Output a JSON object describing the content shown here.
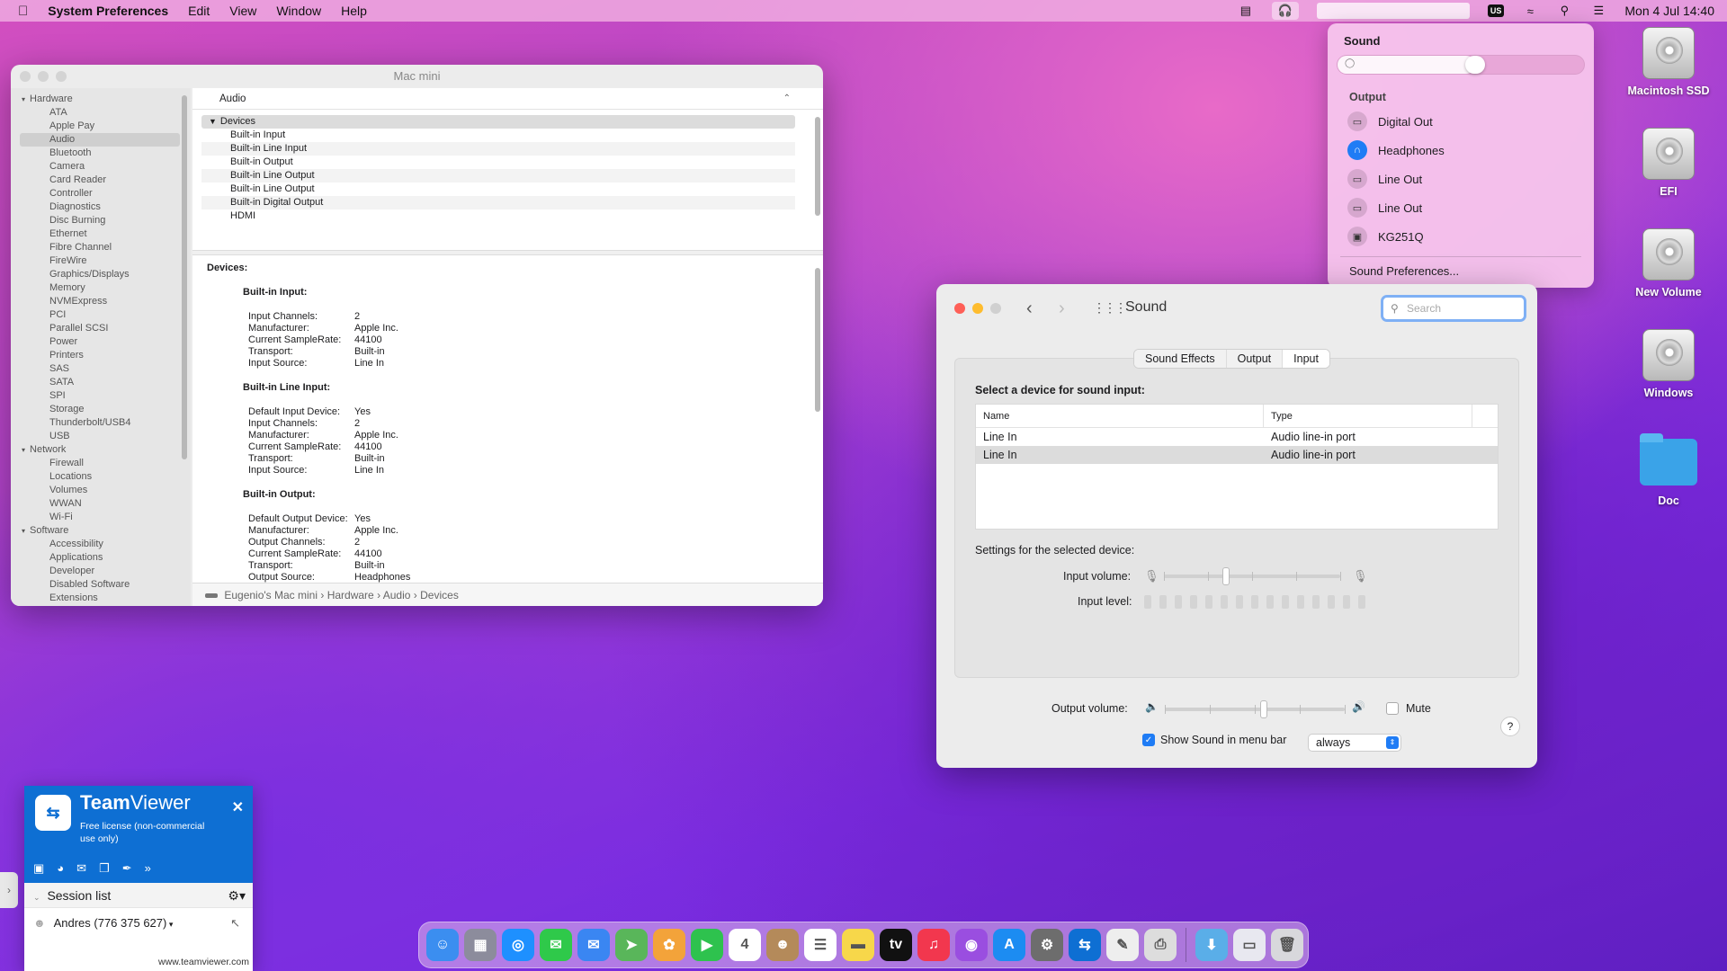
{
  "menubar": {
    "app_name": "System Preferences",
    "menus": [
      "Edit",
      "View",
      "Window",
      "Help"
    ],
    "keyboard_layout": "US",
    "datetime": "Mon 4 Jul  14:40"
  },
  "sysinfo": {
    "window_title": "Mac mini",
    "sidebar": [
      {
        "label": "Hardware",
        "type": "group"
      },
      {
        "label": "ATA",
        "type": "item"
      },
      {
        "label": "Apple Pay",
        "type": "item"
      },
      {
        "label": "Audio",
        "type": "item",
        "selected": true
      },
      {
        "label": "Bluetooth",
        "type": "item"
      },
      {
        "label": "Camera",
        "type": "item"
      },
      {
        "label": "Card Reader",
        "type": "item"
      },
      {
        "label": "Controller",
        "type": "item"
      },
      {
        "label": "Diagnostics",
        "type": "item"
      },
      {
        "label": "Disc Burning",
        "type": "item"
      },
      {
        "label": "Ethernet",
        "type": "item"
      },
      {
        "label": "Fibre Channel",
        "type": "item"
      },
      {
        "label": "FireWire",
        "type": "item"
      },
      {
        "label": "Graphics/Displays",
        "type": "item"
      },
      {
        "label": "Memory",
        "type": "item"
      },
      {
        "label": "NVMExpress",
        "type": "item"
      },
      {
        "label": "PCI",
        "type": "item"
      },
      {
        "label": "Parallel SCSI",
        "type": "item"
      },
      {
        "label": "Power",
        "type": "item"
      },
      {
        "label": "Printers",
        "type": "item"
      },
      {
        "label": "SAS",
        "type": "item"
      },
      {
        "label": "SATA",
        "type": "item"
      },
      {
        "label": "SPI",
        "type": "item"
      },
      {
        "label": "Storage",
        "type": "item"
      },
      {
        "label": "Thunderbolt/USB4",
        "type": "item"
      },
      {
        "label": "USB",
        "type": "item"
      },
      {
        "label": "Network",
        "type": "group"
      },
      {
        "label": "Firewall",
        "type": "item"
      },
      {
        "label": "Locations",
        "type": "item"
      },
      {
        "label": "Volumes",
        "type": "item"
      },
      {
        "label": "WWAN",
        "type": "item"
      },
      {
        "label": "Wi-Fi",
        "type": "item"
      },
      {
        "label": "Software",
        "type": "group"
      },
      {
        "label": "Accessibility",
        "type": "item"
      },
      {
        "label": "Applications",
        "type": "item"
      },
      {
        "label": "Developer",
        "type": "item"
      },
      {
        "label": "Disabled Software",
        "type": "item"
      },
      {
        "label": "Extensions",
        "type": "item"
      }
    ],
    "section_header": "Audio",
    "tree_root": "Devices",
    "tree_items": [
      "Built-in Input",
      "Built-in Line Input",
      "Built-in Output",
      "Built-in Line Output",
      "Built-in Line Output",
      "Built-in Digital Output",
      "HDMI"
    ],
    "detail_heading": "Devices:",
    "detail_blocks": [
      {
        "title": "Built-in Input:",
        "rows": [
          [
            "Input Channels:",
            "2"
          ],
          [
            "Manufacturer:",
            "Apple Inc."
          ],
          [
            "Current SampleRate:",
            "44100"
          ],
          [
            "Transport:",
            "Built-in"
          ],
          [
            "Input Source:",
            "Line In"
          ]
        ]
      },
      {
        "title": "Built-in Line Input:",
        "rows": [
          [
            "Default Input Device:",
            "Yes"
          ],
          [
            "Input Channels:",
            "2"
          ],
          [
            "Manufacturer:",
            "Apple Inc."
          ],
          [
            "Current SampleRate:",
            "44100"
          ],
          [
            "Transport:",
            "Built-in"
          ],
          [
            "Input Source:",
            "Line In"
          ]
        ]
      },
      {
        "title": "Built-in Output:",
        "rows": [
          [
            "Default Output Device:",
            "Yes"
          ],
          [
            "Manufacturer:",
            "Apple Inc."
          ],
          [
            "Output Channels:",
            "2"
          ],
          [
            "Current SampleRate:",
            "44100"
          ],
          [
            "Transport:",
            "Built-in"
          ],
          [
            "Output Source:",
            "Headphones"
          ]
        ]
      }
    ],
    "path": [
      "Eugenio's Mac mini",
      "Hardware",
      "Audio",
      "Devices"
    ]
  },
  "sound_popover": {
    "title": "Sound",
    "volume_fraction": 0.56,
    "output_label": "Output",
    "devices": [
      {
        "label": "Digital Out",
        "icon": "port-icon",
        "selected": false
      },
      {
        "label": "Headphones",
        "icon": "headphones-icon",
        "selected": true
      },
      {
        "label": "Line Out",
        "icon": "port-icon",
        "selected": false
      },
      {
        "label": "Line Out",
        "icon": "port-icon",
        "selected": false
      },
      {
        "label": "KG251Q",
        "icon": "display-icon",
        "selected": false
      }
    ],
    "preferences_link": "Sound Preferences..."
  },
  "sound_window": {
    "title": "Sound",
    "search_placeholder": "Search",
    "tabs": [
      "Sound Effects",
      "Output",
      "Input"
    ],
    "active_tab": "Input",
    "select_prompt": "Select a device for sound input:",
    "columns": [
      "Name",
      "Type"
    ],
    "rows": [
      [
        "Line In",
        "Audio line-in port"
      ],
      [
        "Line In",
        "Audio line-in port"
      ]
    ],
    "selected_row": 1,
    "settings_label": "Settings for the selected device:",
    "input_volume_label": "Input volume:",
    "input_volume_fraction": 0.35,
    "input_level_label": "Input level:",
    "output_volume_label": "Output volume:",
    "output_volume_fraction": 0.55,
    "mute_label": "Mute",
    "mute_checked": false,
    "show_in_menubar_label": "Show Sound in menu bar",
    "show_in_menubar_checked": true,
    "menubar_option": "always",
    "help": "?"
  },
  "desktop_icons": [
    {
      "label": "Macintosh SSD",
      "kind": "disk"
    },
    {
      "label": "EFI",
      "kind": "disk"
    },
    {
      "label": "New Volume",
      "kind": "disk"
    },
    {
      "label": "Windows",
      "kind": "disk"
    },
    {
      "label": "Doc",
      "kind": "folder"
    }
  ],
  "teamviewer": {
    "brand_a": "Team",
    "brand_b": "Viewer",
    "license": "Free license (non-commercial use only)",
    "session_list": "Session list",
    "user": "Andres (776 375 627)",
    "url": "www.teamviewer.com"
  },
  "dock": [
    {
      "name": "finder-icon",
      "color": "#3b8ef0",
      "glyph": "☺"
    },
    {
      "name": "launchpad-icon",
      "color": "#8c8c9c",
      "glyph": "▦"
    },
    {
      "name": "safari-icon",
      "color": "#1e90ff",
      "glyph": "◎"
    },
    {
      "name": "messages-icon",
      "color": "#2fc94a",
      "glyph": "✉"
    },
    {
      "name": "mail-icon",
      "color": "#3a86f2",
      "glyph": "✉"
    },
    {
      "name": "maps-icon",
      "color": "#59b65a",
      "glyph": "➤"
    },
    {
      "name": "photos-icon",
      "color": "#f3a33a",
      "glyph": "✿"
    },
    {
      "name": "facetime-icon",
      "color": "#2ec24e",
      "glyph": "▶"
    },
    {
      "name": "calendar-icon",
      "color": "#ffffff",
      "glyph": "4"
    },
    {
      "name": "contacts-icon",
      "color": "#b48a5a",
      "glyph": "☻"
    },
    {
      "name": "reminders-icon",
      "color": "#ffffff",
      "glyph": "☰"
    },
    {
      "name": "notes-icon",
      "color": "#f7d74a",
      "glyph": "▬"
    },
    {
      "name": "appletv-icon",
      "color": "#111111",
      "glyph": "tv"
    },
    {
      "name": "music-icon",
      "color": "#f2374e",
      "glyph": "♫"
    },
    {
      "name": "podcasts-icon",
      "color": "#9a4ee0",
      "glyph": "◉"
    },
    {
      "name": "appstore-icon",
      "color": "#1c8cf2",
      "glyph": "A"
    },
    {
      "name": "system-preferences-icon",
      "color": "#6d6d6d",
      "glyph": "⚙"
    },
    {
      "name": "teamviewer-icon",
      "color": "#0e6fd3",
      "glyph": "⇆"
    },
    {
      "name": "textedit-icon",
      "color": "#eeeeee",
      "glyph": "✎"
    },
    {
      "name": "printer-icon",
      "color": "#dddddd",
      "glyph": "⎙"
    },
    {
      "name": "sep",
      "color": "",
      "glyph": ""
    },
    {
      "name": "downloads-folder-icon",
      "color": "#5aaee8",
      "glyph": "⬇"
    },
    {
      "name": "screenshot-icon",
      "color": "#e8e8f0",
      "glyph": "▭"
    },
    {
      "name": "trash-icon",
      "color": "#d8d8dc",
      "glyph": "🗑"
    }
  ]
}
